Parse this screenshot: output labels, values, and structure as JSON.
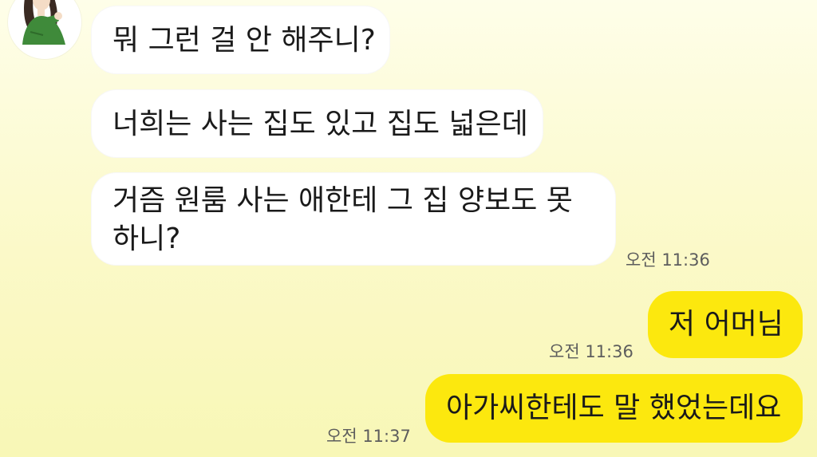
{
  "chat": {
    "avatar_icon": "person-avatar-icon",
    "messages": [
      {
        "direction": "in",
        "text": "뭐 그런 걸 안 해주니?"
      },
      {
        "direction": "in",
        "text": "너희는 사는 집도 있고 집도 넓은데"
      },
      {
        "direction": "in",
        "text": "거즘 원룸 사는 애한테 그 집 양보도 못 하니?",
        "time": "오전 11:36"
      },
      {
        "direction": "out",
        "text": "저 어머님",
        "time": "오전 11:36"
      },
      {
        "direction": "out",
        "text": "아가씨한테도 말 했었는데요",
        "time": "오전 11:37"
      }
    ]
  },
  "colors": {
    "incoming_bubble": "#ffffff",
    "outgoing_bubble": "#fce80e",
    "background_top": "#fefee9",
    "background_bottom": "#f8f7b6",
    "timestamp": "#5d5d5d"
  }
}
